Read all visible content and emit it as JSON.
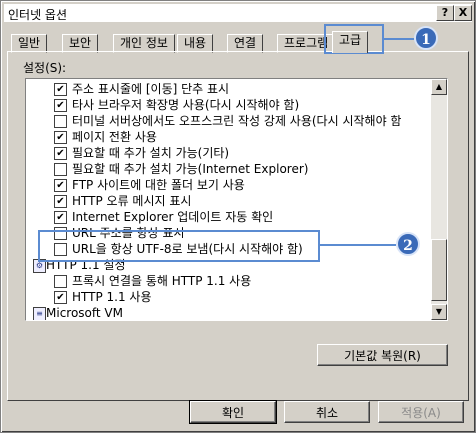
{
  "window": {
    "title": "인터넷 옵션",
    "help_label": "?",
    "close_label": "X"
  },
  "tabs": [
    {
      "label": "일반"
    },
    {
      "label": "보안"
    },
    {
      "label": "개인 정보"
    },
    {
      "label": "내용"
    },
    {
      "label": "연결"
    },
    {
      "label": "프로그램"
    },
    {
      "label": "고급",
      "active": true
    }
  ],
  "settings": {
    "group_label": "설정(S):",
    "items": [
      {
        "label": "주소 표시줄에 [이동] 단추 표시",
        "checked": true
      },
      {
        "label": "타사 브라우저 확장명 사용(다시 시작해야 함)",
        "checked": true
      },
      {
        "label": "터미널 서버상에서도 오프스크린 작성 강제 사용(다시 시작해야 함",
        "checked": false
      },
      {
        "label": "페이지 전환 사용",
        "checked": true
      },
      {
        "label": "필요할 때 추가 설치 가능(기타)",
        "checked": true
      },
      {
        "label": "필요할 때 추가 설치 가능(Internet Explorer)",
        "checked": false
      },
      {
        "label": "FTP 사이트에 대한 폴더 보기 사용",
        "checked": true
      },
      {
        "label": "HTTP 오류 메시지 표시",
        "checked": true
      },
      {
        "label": "Internet Explorer 업데이트 자동 확인",
        "checked": true
      },
      {
        "label": "URL 주소를 항상 표시",
        "checked": false
      },
      {
        "label": "URL을 항상 UTF-8로 보냄(다시 시작해야 함)",
        "checked": false
      },
      {
        "label": "HTTP 1.1 설정",
        "section": true
      },
      {
        "label": "프록시 연결을 통해 HTTP 1.1 사용",
        "checked": false
      },
      {
        "label": "HTTP 1.1 사용",
        "checked": true
      },
      {
        "label": "Microsoft VM",
        "section": true
      }
    ]
  },
  "buttons": {
    "restore_defaults": "기본값 복원(R)",
    "ok": "확인",
    "cancel": "취소",
    "apply": "적용(A)"
  },
  "callouts": {
    "one": "1",
    "two": "2"
  },
  "colors": {
    "callout_blue": "#3a6ab8",
    "dialog_gray": "#d4d0c8"
  }
}
